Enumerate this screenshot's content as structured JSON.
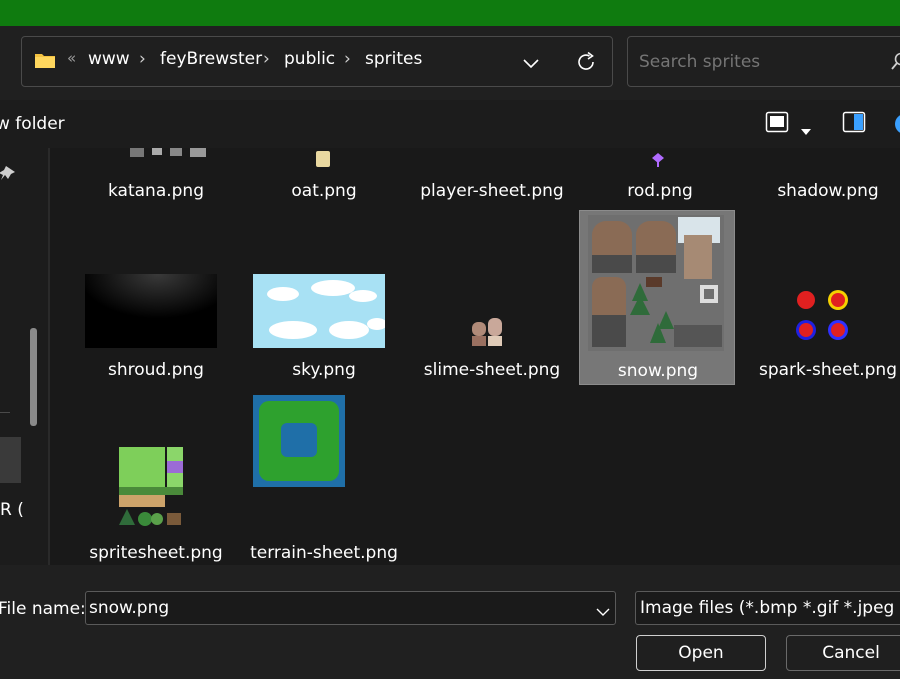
{
  "address": {
    "overflow_glyph": "«",
    "separator": "›",
    "crumbs": [
      "www",
      "feyBrewster",
      "public",
      "sprites"
    ]
  },
  "search": {
    "placeholder": "Search sprites"
  },
  "toolbar": {
    "new_folder_label": "w folder"
  },
  "sidebar": {
    "partial_label": "R ("
  },
  "files": [
    {
      "name": "katana.png"
    },
    {
      "name": "oat.png"
    },
    {
      "name": "player-sheet.png"
    },
    {
      "name": "rod.png"
    },
    {
      "name": "shadow.png"
    },
    {
      "name": "shroud.png"
    },
    {
      "name": "sky.png"
    },
    {
      "name": "slime-sheet.png"
    },
    {
      "name": "snow.png",
      "selected": true
    },
    {
      "name": "spark-sheet.png"
    },
    {
      "name": "spritesheet.png"
    },
    {
      "name": "terrain-sheet.png"
    }
  ],
  "footer": {
    "file_name_label": "File name:",
    "file_name_value": "snow.png",
    "file_type_value": "Image files (*.bmp *.gif *.jpeg *",
    "open_label": "Open",
    "cancel_label": "Cancel"
  },
  "colors": {
    "title_bar": "#0f7b0f",
    "background": "#191919",
    "selection": "#777777"
  },
  "icons": [
    "folder-icon",
    "chevron-down-icon",
    "refresh-icon",
    "search-icon",
    "view-toggle-icon",
    "preview-pane-icon",
    "help-icon",
    "pin-icon"
  ]
}
